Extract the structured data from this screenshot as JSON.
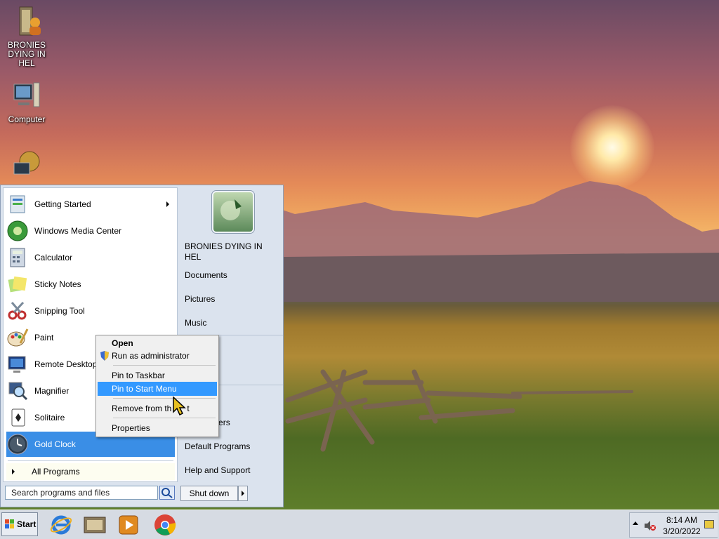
{
  "desktop": {
    "icons": [
      {
        "label": "BRONIES DYING IN HEL",
        "icon": "user-folder-icon"
      },
      {
        "label": "Computer",
        "icon": "computer-icon"
      },
      {
        "label": "",
        "icon": "network-icon"
      }
    ]
  },
  "start_menu": {
    "programs": [
      {
        "label": "Getting Started",
        "icon": "getting-started-icon",
        "has_submenu": true
      },
      {
        "label": "Windows Media Center",
        "icon": "media-center-icon"
      },
      {
        "label": "Calculator",
        "icon": "calculator-icon"
      },
      {
        "label": "Sticky Notes",
        "icon": "sticky-notes-icon"
      },
      {
        "label": "Snipping Tool",
        "icon": "snipping-tool-icon"
      },
      {
        "label": "Paint",
        "icon": "paint-icon"
      },
      {
        "label": "Remote Desktop",
        "icon": "remote-desktop-icon"
      },
      {
        "label": "Magnifier",
        "icon": "magnifier-icon"
      },
      {
        "label": "Solitaire",
        "icon": "solitaire-icon"
      },
      {
        "label": "Gold Clock",
        "icon": "clock-icon",
        "selected": true
      }
    ],
    "all_programs": "All Programs",
    "search_placeholder": "Search programs and files",
    "user_name": "BRONIES DYING IN HEL",
    "right_items": [
      "Documents",
      "Pictures",
      "Music",
      "er",
      "Panel",
      "and Printers",
      "Default Programs",
      "Help and Support"
    ],
    "shutdown_label": "Shut down"
  },
  "context_menu": {
    "items": [
      "Open",
      "Run as administrator",
      "Pin to Taskbar",
      "Pin to Start Menu",
      "Remove from th",
      "t",
      "Properties"
    ],
    "highlighted": "Pin to Start Menu"
  },
  "taskbar": {
    "start_label": "Start",
    "pinned": [
      "internet-explorer-icon",
      "film-strip-icon",
      "media-player-icon",
      "chrome-icon"
    ],
    "clock_time": "8:14 AM",
    "clock_date": "3/20/2022"
  },
  "colors": {
    "selection_blue": "#3a8ee6",
    "context_highlight": "#3399ff"
  }
}
